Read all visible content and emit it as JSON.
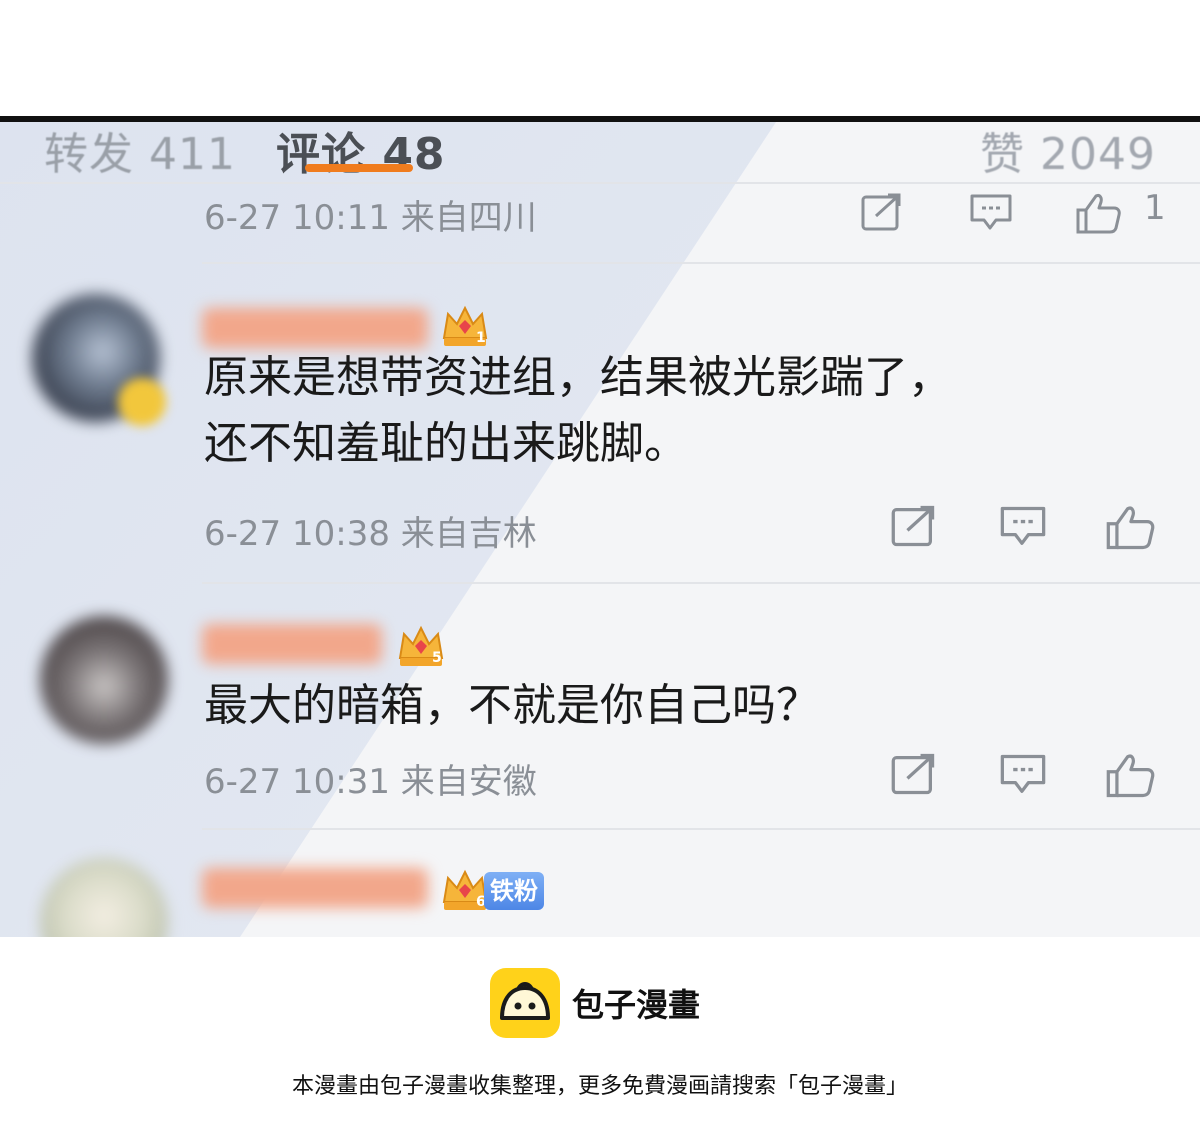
{
  "tabs": {
    "repost": "转发 411",
    "comment": "评论 48",
    "like": "赞 2049"
  },
  "comments": [
    {
      "meta": "6-27 10:11 来自四川",
      "like_count": "1"
    },
    {
      "level": "1",
      "text_line1": "原来是想带资进组，结果被光影踹了，",
      "text_line2": "还不知羞耻的出来跳脚。",
      "meta": "6-27 10:38 来自吉林"
    },
    {
      "level": "5",
      "text_line1": "最大的暗箱，不就是你自己吗？",
      "meta": "6-27 10:31 来自安徽"
    },
    {
      "level": "6",
      "badge": "铁粉"
    }
  ],
  "icons": {
    "repost": "share-box-icon",
    "comment": "comment-bubble-icon",
    "like": "thumbs-up-icon",
    "crown": "crown-level-icon",
    "logo": "bun-logo-icon"
  },
  "colors": {
    "accent": "#f07c1e",
    "meta_text": "#8a8f96",
    "badge_blue": "#4d86e6",
    "brand_yellow": "#ffd21a"
  },
  "footer": {
    "brand": "包子漫畫",
    "notice": "本漫畫由包子漫畫收集整理，更多免費漫画請搜索「包子漫畫」"
  }
}
